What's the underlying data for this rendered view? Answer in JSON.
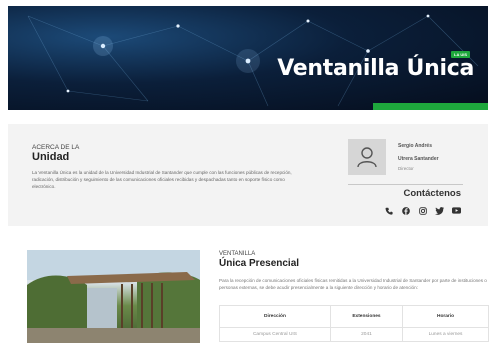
{
  "hero": {
    "title": "Ventanilla Única",
    "badge": "LA UIS"
  },
  "about": {
    "kicker": "ACERCA DE LA",
    "title": "Unidad",
    "text": "La Ventanilla Única es la unidad de la Universidad Industrial de Santander que cumple con las funciones públicas de recepción, radicación, distribución y seguimiento de las comunicaciones oficiales recibidas y despachadas tanto en soporte físico como electrónico."
  },
  "director": {
    "name_line1": "Sergio Andrés",
    "name_line2": "Utrera Santander",
    "role": "Director"
  },
  "contact": {
    "title": "Contáctenos",
    "icons": [
      "phone-icon",
      "facebook-icon",
      "instagram-icon",
      "twitter-icon",
      "youtube-icon"
    ]
  },
  "presencial": {
    "kicker": "VENTANILLA",
    "title": "Única Presencial",
    "text": "Para la recepción de comunicaciones oficiales físicas remitidas a la Universidad Industrial de Santander por parte de instituciones o personas externas, se debe acudir presencialmente a la siguiente dirección y horario de atención:",
    "table": {
      "headers": [
        "Dirección",
        "Extensiones",
        "Horario"
      ],
      "rows": [
        [
          "Campus Central UIS",
          "2041",
          "Lunes a viernes"
        ]
      ]
    }
  },
  "colors": {
    "accent_green": "#1ea83c",
    "hero_dark": "#0b1f3a"
  }
}
